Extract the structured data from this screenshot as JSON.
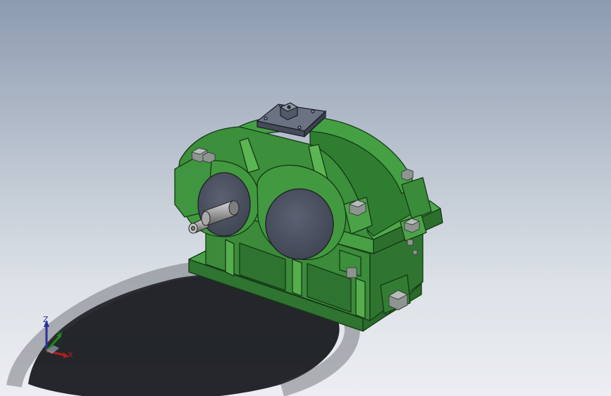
{
  "viewport": {
    "background_top": "#8d9bb0",
    "background_bottom": "#eceef1"
  },
  "model": {
    "description_icon": "gear-reducer-housing",
    "body_color": "#3c8e3c",
    "body_highlight": "#56ae4c",
    "body_dark": "#2c6b2c",
    "outline_color": "#163816",
    "bearing_cap_color": "#4d5363",
    "shaft_color": "#9a9a9a",
    "bolt_color": "#8e9591",
    "inspection_cover_color": "#5b6270"
  },
  "triad": {
    "x_label": "X",
    "y_label": "Y",
    "z_label": "Z",
    "x_color": "#b31e1e",
    "y_color": "#1d8a1d",
    "z_color": "#2d2f9e"
  }
}
